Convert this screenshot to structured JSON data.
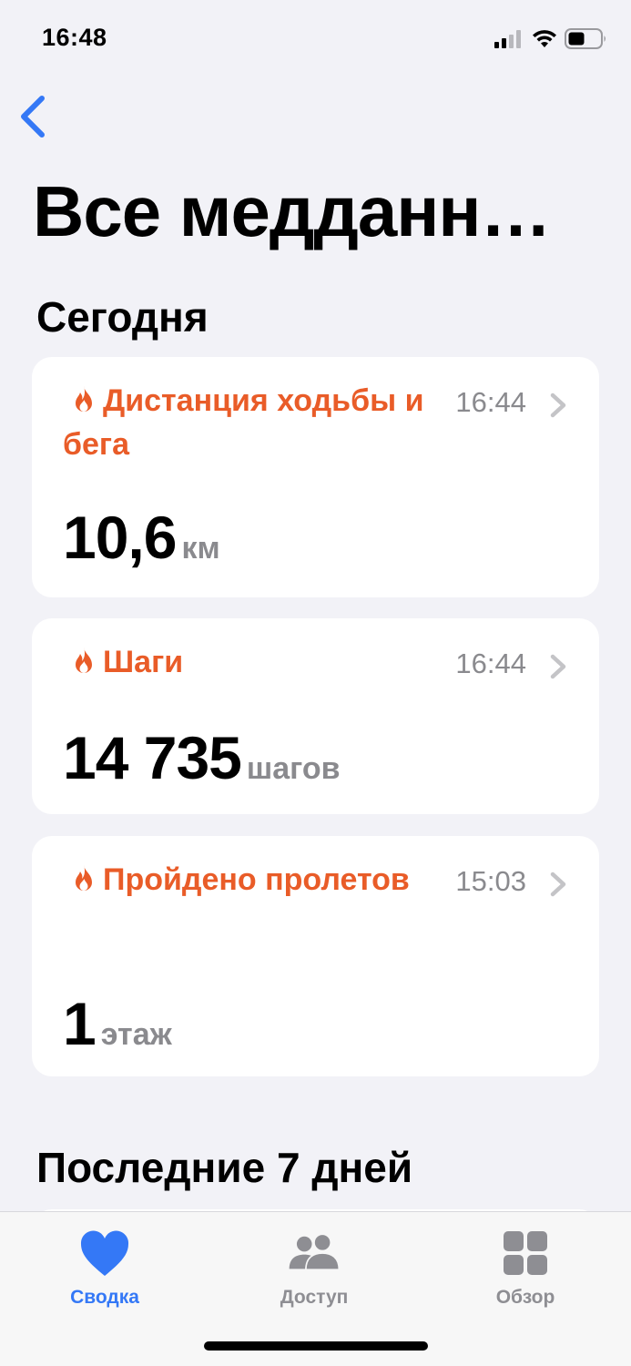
{
  "status_bar": {
    "time": "16:48",
    "icons": [
      "signal-icon",
      "wifi-icon",
      "battery-icon"
    ]
  },
  "nav": {
    "back_icon": "chevron-left-icon",
    "title": "Все меддан­н…"
  },
  "sections": {
    "today": "Сегодня",
    "last_7_days": "Последние 7 дней"
  },
  "cards": [
    {
      "label": "Дистанция ходьбы и бега",
      "time": "16:44",
      "value": "10,6",
      "unit": "км",
      "icon": "fire-icon"
    },
    {
      "label": "Шаги",
      "time": "16:44",
      "value": "14 735",
      "unit": "шагов",
      "icon": "fire-icon"
    },
    {
      "label": "Пройдено пролетов",
      "time": "15:03",
      "value": "1",
      "unit": "этаж",
      "icon": "fire-icon"
    }
  ],
  "tab_bar": {
    "tabs": [
      {
        "label": "Сводка",
        "icon": "heart-icon",
        "selected": true
      },
      {
        "label": "Доступ",
        "icon": "people-icon",
        "selected": false
      },
      {
        "label": "Обзор",
        "icon": "grid-icon",
        "selected": false
      }
    ]
  },
  "colors": {
    "accent": "#3478f6",
    "activity": "#e95c28",
    "background": "#f2f2f7",
    "secondary_text": "#8a8a8e"
  }
}
